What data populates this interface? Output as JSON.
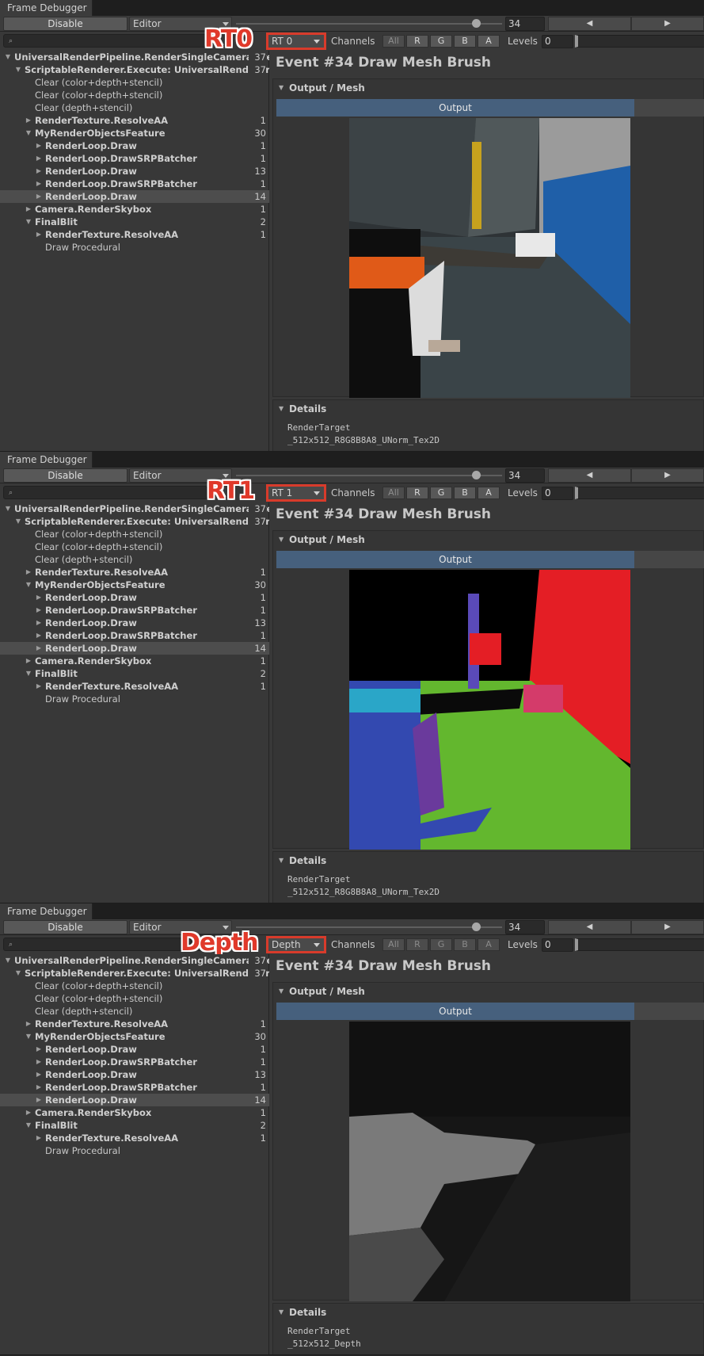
{
  "window": {
    "tab_title": "Frame Debugger",
    "disable_label": "Disable",
    "editor_dropdown": "Editor",
    "event_number": "34",
    "prev_glyph": "◀",
    "next_glyph": "▶"
  },
  "channels": {
    "label": "Channels",
    "buttons": [
      "All",
      "R",
      "G",
      "B",
      "A"
    ]
  },
  "levels": {
    "label": "Levels",
    "value": "0"
  },
  "tree": [
    {
      "label": "UniversalRenderPipeline.RenderSingleCameraInternal",
      "count": "37",
      "level": 0,
      "bold": true,
      "arrow": "down"
    },
    {
      "label": "ScriptableRenderer.Execute: UniversalRenderer",
      "count": "37",
      "level": 1,
      "bold": true,
      "arrow": "down"
    },
    {
      "label": "Clear (color+depth+stencil)",
      "count": "",
      "level": 2,
      "bold": false,
      "arrow": ""
    },
    {
      "label": "Clear (color+depth+stencil)",
      "count": "",
      "level": 2,
      "bold": false,
      "arrow": ""
    },
    {
      "label": "Clear (depth+stencil)",
      "count": "",
      "level": 2,
      "bold": false,
      "arrow": ""
    },
    {
      "label": "RenderTexture.ResolveAA",
      "count": "1",
      "level": 2,
      "bold": true,
      "arrow": "right"
    },
    {
      "label": "MyRenderObjectsFeature",
      "count": "30",
      "level": 2,
      "bold": true,
      "arrow": "down"
    },
    {
      "label": "RenderLoop.Draw",
      "count": "1",
      "level": 3,
      "bold": true,
      "arrow": "right"
    },
    {
      "label": "RenderLoop.DrawSRPBatcher",
      "count": "1",
      "level": 3,
      "bold": true,
      "arrow": "right"
    },
    {
      "label": "RenderLoop.Draw",
      "count": "13",
      "level": 3,
      "bold": true,
      "arrow": "right"
    },
    {
      "label": "RenderLoop.DrawSRPBatcher",
      "count": "1",
      "level": 3,
      "bold": true,
      "arrow": "right"
    },
    {
      "label": "RenderLoop.Draw",
      "count": "14",
      "level": 3,
      "bold": true,
      "arrow": "right",
      "selected": true
    },
    {
      "label": "Camera.RenderSkybox",
      "count": "1",
      "level": 2,
      "bold": true,
      "arrow": "right"
    },
    {
      "label": "FinalBlit",
      "count": "2",
      "level": 2,
      "bold": true,
      "arrow": "down"
    },
    {
      "label": "RenderTexture.ResolveAA",
      "count": "1",
      "level": 3,
      "bold": true,
      "arrow": "right"
    },
    {
      "label": "Draw Procedural",
      "count": "",
      "level": 3,
      "bold": false,
      "arrow": ""
    }
  ],
  "event": {
    "title": "Event #34 Draw Mesh Brush",
    "output_section": "Output / Mesh",
    "output_tab": "Output",
    "details_section": "Details",
    "details_key": "RenderTarget"
  },
  "panels": [
    {
      "callout": "RT0",
      "target": "RT 0",
      "format": "_512x512_R8G8B8A8_UNorm_Tex2D",
      "channels_active": true
    },
    {
      "callout": "RT1",
      "target": "RT 1",
      "format": "_512x512_R8G8B8A8_UNorm_Tex2D",
      "channels_active": true
    },
    {
      "callout": "Depth",
      "target": "Depth",
      "format": "_512x512_Depth",
      "channels_active": false
    }
  ],
  "colors": {
    "callout": "#e0392a",
    "output_tab": "#46607d",
    "selected_row": "#4d4d4d"
  }
}
